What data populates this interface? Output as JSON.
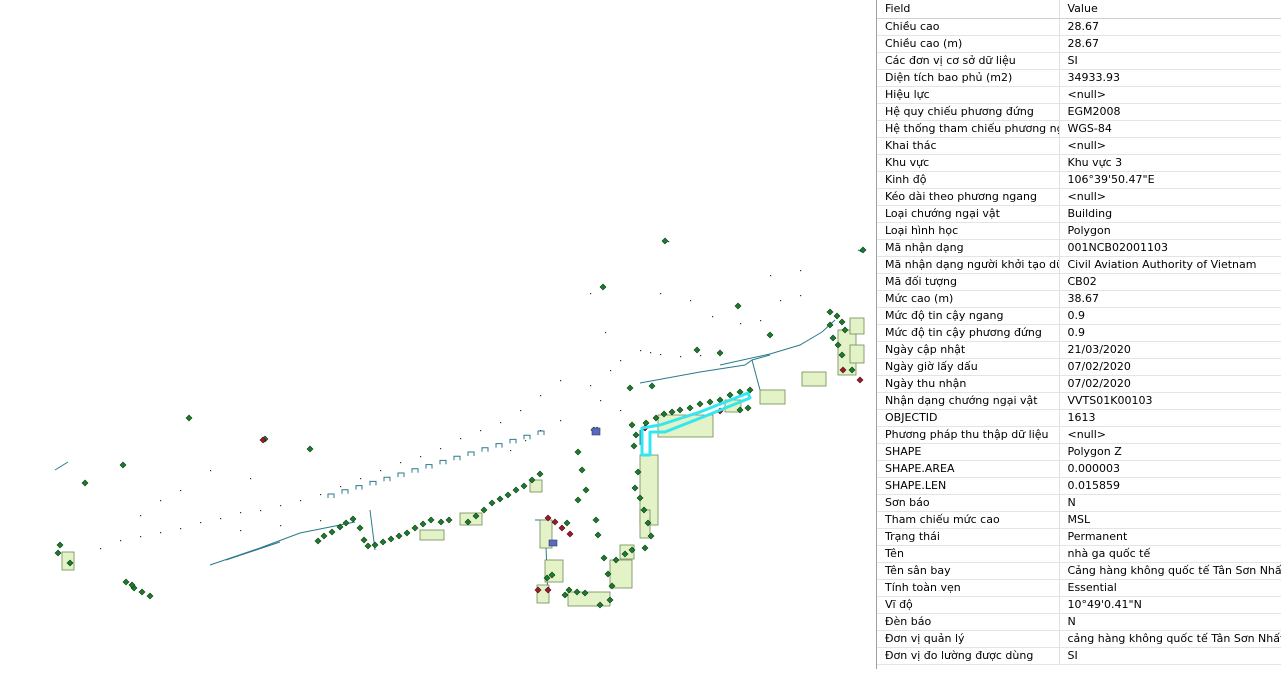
{
  "table": {
    "header_field": "Field",
    "header_value": "Value",
    "rows": [
      {
        "field": "Chiều cao",
        "value": "28.67"
      },
      {
        "field": "Chiều cao (m)",
        "value": "28.67"
      },
      {
        "field": "Các đơn vị cơ sở dữ liệu",
        "value": "SI"
      },
      {
        "field": "Diện tích bao phủ (m2)",
        "value": "34933.93"
      },
      {
        "field": "Hiệu lực",
        "value": "<null>"
      },
      {
        "field": "Hệ quy chiếu phương đứng",
        "value": "EGM2008"
      },
      {
        "field": "Hệ thống tham chiếu phương ngang",
        "value": "WGS-84"
      },
      {
        "field": "Khai thác",
        "value": "<null>"
      },
      {
        "field": "Khu vực",
        "value": "Khu vực 3"
      },
      {
        "field": "Kinh độ",
        "value": "106°39'50.47\"E"
      },
      {
        "field": "Kéo dài theo phương ngang",
        "value": "<null>"
      },
      {
        "field": "Loại chướng ngại vật",
        "value": "Building"
      },
      {
        "field": "Loại hình học",
        "value": "Polygon"
      },
      {
        "field": "Mã nhận dạng",
        "value": "001NCB02001103"
      },
      {
        "field": "Mã nhận dạng người khởi tạo dữ liệu",
        "value": "Civil Aviation Authority of Vietnam"
      },
      {
        "field": "Mã đối tượng",
        "value": "CB02"
      },
      {
        "field": "Mức cao (m)",
        "value": "38.67"
      },
      {
        "field": "Mức độ tin cậy ngang",
        "value": "0.9"
      },
      {
        "field": "Mức độ tin cậy phương đứng",
        "value": "0.9"
      },
      {
        "field": "Ngày cập nhật",
        "value": "21/03/2020"
      },
      {
        "field": "Ngày giờ lấy dấu",
        "value": "07/02/2020"
      },
      {
        "field": "Ngày thu nhận",
        "value": "07/02/2020"
      },
      {
        "field": "Nhận dạng chướng ngại vật",
        "value": "VVTS01K00103"
      },
      {
        "field": "OBJECTID",
        "value": "1613"
      },
      {
        "field": "Phương pháp thu thập dữ liệu",
        "value": "<null>"
      },
      {
        "field": "SHAPE",
        "value": "Polygon Z"
      },
      {
        "field": "SHAPE.AREA",
        "value": "0.000003"
      },
      {
        "field": "SHAPE.LEN",
        "value": "0.015859"
      },
      {
        "field": "Sơn báo",
        "value": "N"
      },
      {
        "field": "Tham chiếu mức cao",
        "value": "MSL"
      },
      {
        "field": "Trạng thái",
        "value": "Permanent"
      },
      {
        "field": "Tên",
        "value": "nhà ga quốc tế"
      },
      {
        "field": "Tên sân bay",
        "value": "Cảng hàng không quốc tế Tân Sơn Nhất"
      },
      {
        "field": "Tính toàn vẹn",
        "value": "Essential"
      },
      {
        "field": "Vĩ độ",
        "value": "10°49'0.41\"N"
      },
      {
        "field": "Đèn báo",
        "value": "N"
      },
      {
        "field": "Đơn vị quản lý",
        "value": "cảng hàng không quốc tế Tân Sơn Nhất"
      },
      {
        "field": "Đơn vị đo lường được dùng",
        "value": "SI"
      }
    ]
  },
  "map": {
    "colors": {
      "tree_fill": "#1e7a2e",
      "tree_stroke": "#0b3d12",
      "building_fill": "#e4f2c8",
      "building_stroke": "#6f8a55",
      "line": "#2a7a8a",
      "selection": "#33e6f0",
      "red_marker": "#9b1b2e",
      "blue_marker": "#5a6ab8"
    }
  }
}
